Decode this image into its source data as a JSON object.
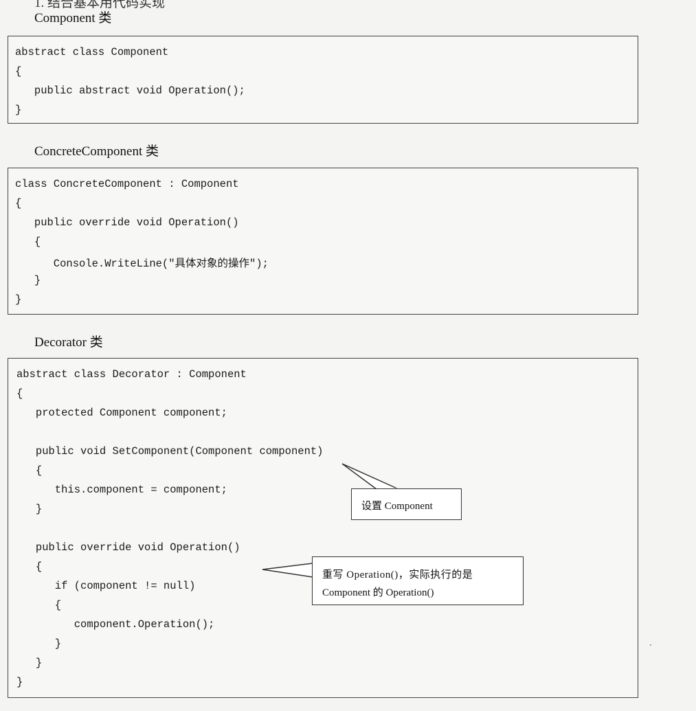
{
  "top_cut_heading": "1. 结合基本用代码实现",
  "sections": [
    {
      "heading": "Component 类",
      "lines": [
        "abstract class Component",
        "{",
        "   public abstract void Operation();",
        "}"
      ]
    },
    {
      "heading": "ConcreteComponent 类",
      "lines": [
        "class ConcreteComponent : Component",
        "{",
        "   public override void Operation()",
        "   {",
        "      Console.WriteLine(\"具体对象的操作\");",
        "   }",
        "}"
      ]
    },
    {
      "heading": "Decorator 类",
      "lines": [
        "abstract class Decorator : Component",
        "{",
        "   protected Component component;",
        "",
        "   public void SetComponent(Component component)",
        "   {",
        "      this.component = component;",
        "   }",
        "",
        "   public override void Operation()",
        "   {",
        "      if (component != null)",
        "      {",
        "         component.Operation();",
        "      }",
        "   }",
        "}"
      ]
    }
  ],
  "callouts": [
    {
      "text": "设置 Component"
    },
    {
      "line1": "重写 Operation()，实际执行的是",
      "line2": "Component 的 Operation()"
    }
  ]
}
